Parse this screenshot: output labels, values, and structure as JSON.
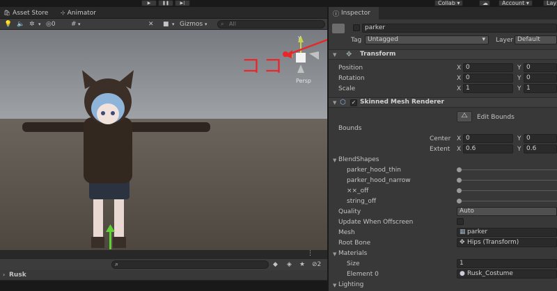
{
  "toolbar": {
    "play_icon": "▶",
    "pause_icon": "❚❚",
    "step_icon": "▶|",
    "collab_label": "Collab",
    "account_label": "Account",
    "layers_label": "Lay"
  },
  "scene": {
    "tabs": [
      {
        "label": "Asset Store",
        "icon": "shopping-bag-icon"
      },
      {
        "label": "Animator",
        "icon": "animator-icon"
      }
    ],
    "toolbar": {
      "hidden_count": "0",
      "gizmos_label": "Gizmos",
      "search_placeholder": "All"
    },
    "annotation": {
      "text": "ココ",
      "color": "#e8262b"
    },
    "gizmo": {
      "y_label": "y",
      "persp_label": "Persp"
    }
  },
  "project": {
    "hidden_count": "2",
    "folder_label": "Rusk"
  },
  "inspector": {
    "tab_label": "Inspector",
    "object_name": "parker",
    "tag_label": "Tag",
    "tag_value": "Untagged",
    "layer_label": "Layer",
    "layer_value": "Default",
    "transform": {
      "title": "Transform",
      "rows": [
        {
          "label": "Position",
          "x": "0",
          "y": "0"
        },
        {
          "label": "Rotation",
          "x": "0",
          "y": "0"
        },
        {
          "label": "Scale",
          "x": "1",
          "y": "1"
        }
      ],
      "x_axis": "X",
      "y_axis": "Y"
    },
    "smr": {
      "title": "Skinned Mesh Renderer",
      "edit_bounds_label": "Edit Bounds",
      "bounds_label": "Bounds",
      "center_label": "Center",
      "center_x": "0",
      "center_y": "0",
      "extent_label": "Extent",
      "extent_x": "0.6",
      "extent_y": "0.6",
      "blendshapes_label": "BlendShapes",
      "blendshapes": [
        {
          "name": "parker_hood_thin",
          "value": 0
        },
        {
          "name": "parker_hood_narrow",
          "value": 0
        },
        {
          "name": "××_off",
          "value": 0
        },
        {
          "name": "string_off",
          "value": 0
        }
      ],
      "quality_label": "Quality",
      "quality_value": "Auto",
      "update_offscreen_label": "Update When Offscreen",
      "mesh_label": "Mesh",
      "mesh_value": "parker",
      "root_bone_label": "Root Bone",
      "root_bone_value": "Hips (Transform)",
      "materials_label": "Materials",
      "size_label": "Size",
      "size_value": "1",
      "element0_label": "Element 0",
      "element0_value": "Rusk_Costume",
      "lighting_label": "Lighting"
    }
  },
  "colors": {
    "sky": "#8a8e93",
    "ground": "#5a524a",
    "accent_red": "#e8262b",
    "gizmo_green": "#5fd234",
    "gizmo_yellow": "#c9d44a"
  }
}
